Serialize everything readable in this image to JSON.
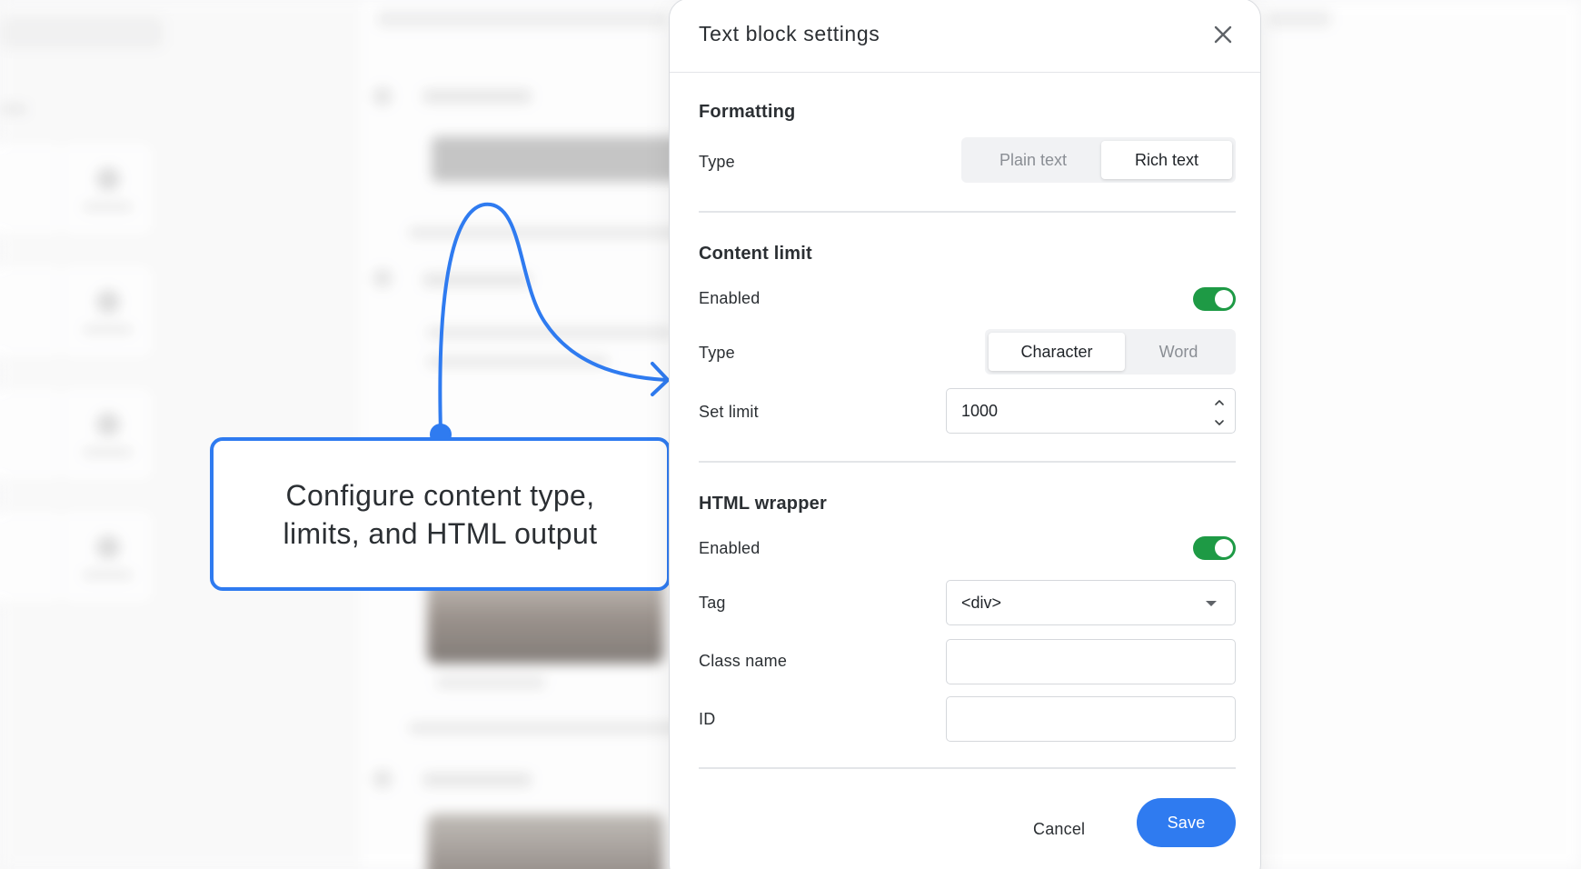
{
  "dialog": {
    "title": "Text block settings"
  },
  "formatting": {
    "section_title": "Formatting",
    "type_label": "Type",
    "options": [
      "Plain text",
      "Rich text"
    ],
    "selected": "Rich text"
  },
  "content_limit": {
    "section_title": "Content limit",
    "enabled_label": "Enabled",
    "enabled": true,
    "type_label": "Type",
    "type_options": [
      "Character",
      "Word"
    ],
    "type_selected": "Character",
    "set_limit_label": "Set limit",
    "limit_value": "1000"
  },
  "html_wrapper": {
    "section_title": "HTML wrapper",
    "enabled_label": "Enabled",
    "enabled": true,
    "tag_label": "Tag",
    "tag_value": "<div>",
    "class_name_label": "Class name",
    "class_name_value": "",
    "id_label": "ID",
    "id_value": ""
  },
  "footer": {
    "cancel_label": "Cancel",
    "save_label": "Save"
  },
  "callout": {
    "line1": "Configure content type,",
    "line2": "limits, and HTML output"
  },
  "colors": {
    "accent": "#2f7bf0",
    "toggle_on": "#1e9a45"
  },
  "icons": {
    "close": "close-icon",
    "stepper_up": "chevron-up-icon",
    "stepper_down": "chevron-down-icon",
    "dropdown": "caret-down-icon"
  }
}
